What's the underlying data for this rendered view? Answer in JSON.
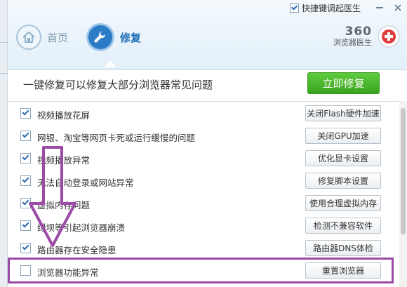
{
  "topbar": {
    "shortcut_label": "快捷键调起医生"
  },
  "nav": {
    "home_label": "首页",
    "repair_label": "修复"
  },
  "brand": {
    "number": "360",
    "subtitle": "浏览器医生"
  },
  "action": {
    "headline": "一键修复可以修复大部分浏览器常见问题",
    "fix_button": "立即修复"
  },
  "items": [
    {
      "label": "视频播放花屏",
      "button": "关闭Flash硬件加速",
      "checked": true
    },
    {
      "label": "网银、淘宝等网页卡死或运行缓慢的问题",
      "button": "关闭GPU加速",
      "checked": true
    },
    {
      "label": "视频播放异常",
      "button": "优化显卡设置",
      "checked": true
    },
    {
      "label": "无法自动登录或网站异常",
      "button": "修复脚本设置",
      "checked": true
    },
    {
      "label": "虚拟内存问题",
      "button": "使用合理虚拟内存",
      "checked": true
    },
    {
      "label": "绿坝等引起浏览器崩溃",
      "button": "检测不兼容软件",
      "checked": true
    },
    {
      "label": "路由器存在安全隐患",
      "button": "路由器DNS体检",
      "checked": true
    },
    {
      "label": "浏览器功能异常",
      "button": "重置浏览器",
      "checked": false
    }
  ],
  "colors": {
    "accent": "#2b7bc7",
    "fix_green": "#3aa31e",
    "annotation": "#9b4aa6"
  }
}
